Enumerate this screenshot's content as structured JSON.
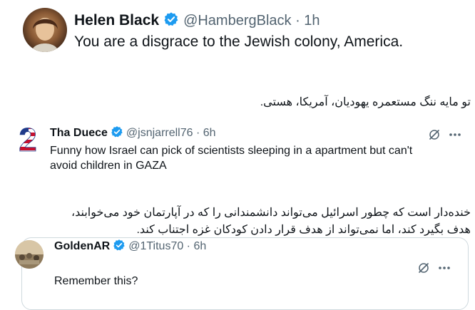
{
  "tweet1": {
    "display_name": "Helen Black",
    "handle_time": "@HambergBlack · 1h",
    "text": "You are a disgrace to the Jewish colony, America."
  },
  "translation1": "تو مایه ننگ مستعمره یهودیان، آمریکا، هستی.",
  "tweet2": {
    "display_name": "Tha Duece",
    "handle_time": "@jsnjarrell76 · 6h",
    "text_line1": "Funny how Israel can pick of scientists sleeping in a apartment but can't",
    "text_line2": "avoid children in GAZA",
    "avatar_glyph": "2"
  },
  "translation2": {
    "line1": "خنده‌دار است که چطور اسرائیل می‌تواند دانشمندانی را که در آپارتمان خود می‌خوابند،",
    "line2": "هدف بگیرد کند، اما نمی‌تواند از هدف قرار دادن کودکان غزه اجتناب کند."
  },
  "tweet3": {
    "display_name": "GoldenAR",
    "handle_time": "@1Titus70 · 6h",
    "text": "Remember this?"
  },
  "colors": {
    "verified": "#1d9bf0",
    "muted": "#536471",
    "border": "#cfd9de"
  },
  "icons": [
    "verified-badge-icon",
    "grok-icon",
    "more-icon"
  ]
}
